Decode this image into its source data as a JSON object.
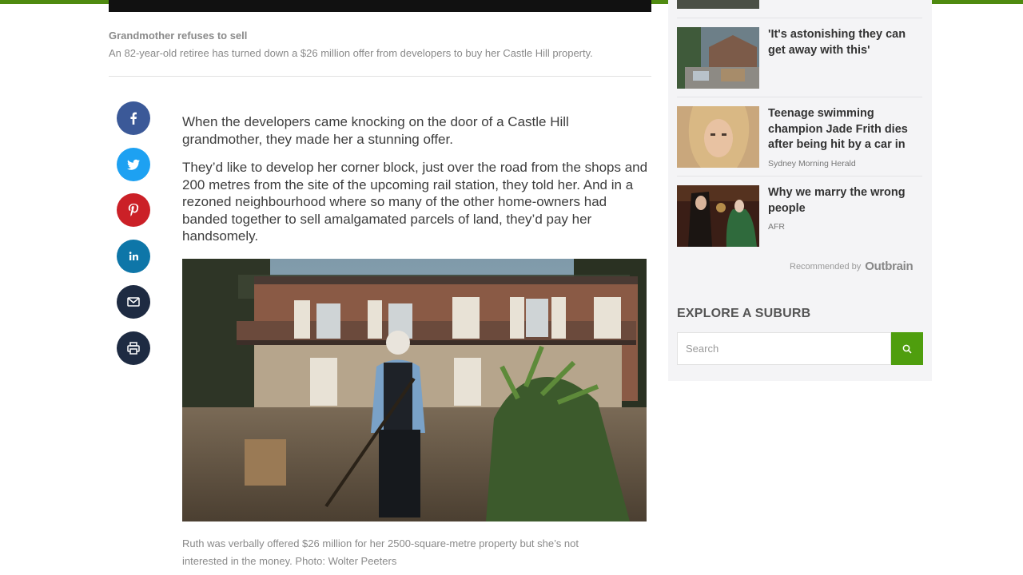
{
  "caption": {
    "title": "Grandmother refuses to sell",
    "description": "An 82-year-old retiree has turned down a $26 million offer from developers to buy her Castle Hill property."
  },
  "share": [
    {
      "name": "facebook",
      "color": "#3b5998",
      "icon": "facebook-icon"
    },
    {
      "name": "twitter",
      "color": "#1da1f2",
      "icon": "twitter-icon"
    },
    {
      "name": "pinterest",
      "color": "#cb2027",
      "icon": "pinterest-icon"
    },
    {
      "name": "linkedin",
      "color": "#0e76a8",
      "icon": "linkedin-icon"
    },
    {
      "name": "email",
      "color": "#1e2b42",
      "icon": "mail-icon"
    },
    {
      "name": "print",
      "color": "#1e2b42",
      "icon": "printer-icon"
    }
  ],
  "article": {
    "paragraphs": [
      "When the developers came knocking on the door of a Castle Hill grandmother, they made her a stunning offer.",
      "They’d like to develop her corner block, just over the road from the shops and 200 metres from the site of the upcoming rail station, they told her. And in a rezoned neighbourhood where so many of the other home-owners had banded together to sell amalgamated parcels of land, they’d pay her handsomely."
    ],
    "photo_caption": "Ruth was verbally offered $26 million for her 2500-square-metre property but she’s not interested in the money. Photo: Wolter Peeters"
  },
  "sidebar": {
    "recommendations": [
      {
        "title": "'It's astonishing they can get away with this'",
        "source": ""
      },
      {
        "title": "Teenage swimming champion Jade Frith dies after being hit by a car in",
        "source": "Sydney Morning Herald"
      },
      {
        "title": "Why we marry the wrong people",
        "source": "AFR"
      }
    ],
    "recommended_by": "Recommended by",
    "recommended_brand": "Outbrain",
    "explore_title": "EXPLORE A SUBURB",
    "search_placeholder": "Search"
  },
  "colors": {
    "accent": "#4f9e0e",
    "top_bar": "#4f8a10"
  }
}
